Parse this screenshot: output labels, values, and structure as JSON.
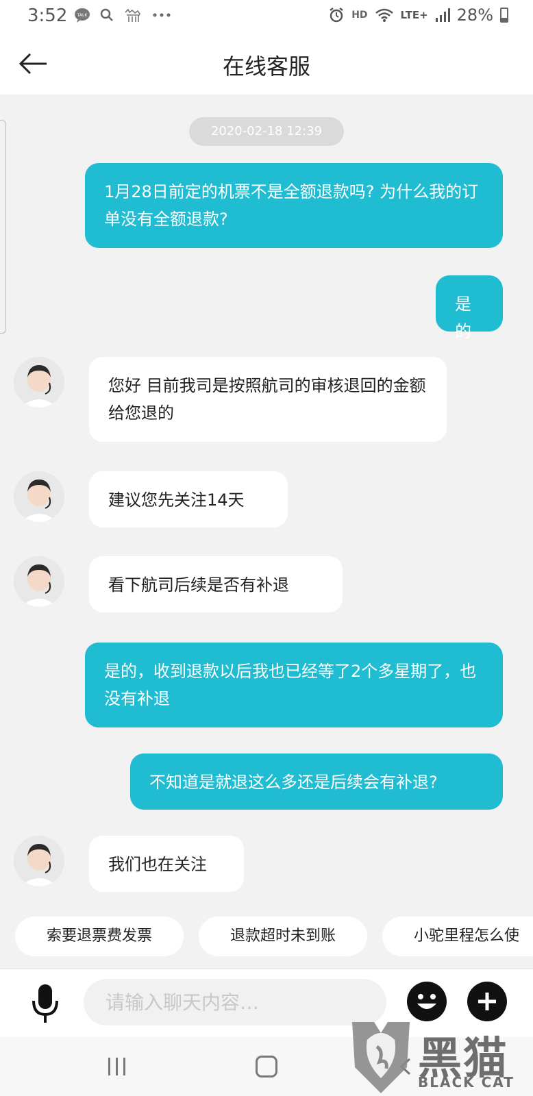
{
  "status_bar": {
    "time": "3:52",
    "network": "LTE+",
    "hd": "HD",
    "battery": "28%",
    "icons": [
      "talk-icon",
      "search-icon",
      "camel-icon",
      "more-icon",
      "alarm-icon",
      "wifi-icon",
      "signal-icon",
      "battery-icon"
    ]
  },
  "header": {
    "title": "在线客服",
    "back_icon": "arrow-left-icon"
  },
  "chat": {
    "timestamp": "2020-02-18 12:39",
    "messages": [
      {
        "from": "me",
        "text": "1月28日前定的机票不是全额退款吗? 为什么我的订单没有全额退款?"
      },
      {
        "from": "me",
        "text": "是的"
      },
      {
        "from": "agent",
        "text": "您好 目前我司是按照航司的审核退回的金额给您退的"
      },
      {
        "from": "agent",
        "text": "建议您先关注14天"
      },
      {
        "from": "agent",
        "text": "看下航司后续是否有补退"
      },
      {
        "from": "me",
        "text": "是的，收到退款以后我也已经等了2个多星期了，也没有补退"
      },
      {
        "from": "me",
        "text": "不知道是就退这么多还是后续会有补退?"
      },
      {
        "from": "agent",
        "text": "我们也在关注"
      }
    ]
  },
  "quick_replies": [
    "索要退票费发票",
    "退款超时未到账",
    "小驼里程怎么使"
  ],
  "composer": {
    "placeholder": "请输入聊天内容…",
    "mic_icon": "microphone-icon",
    "emoji_icon": "emoji-icon",
    "plus_icon": "plus-icon"
  },
  "nav_bar": {
    "icons": [
      "recents-icon",
      "home-icon",
      "back-icon"
    ]
  },
  "watermark": {
    "chinese": "黑猫",
    "english": "BLACK CAT"
  },
  "colors": {
    "accent": "#1fbcd2",
    "background": "#f2f2f2",
    "agent_bubble": "#ffffff"
  }
}
